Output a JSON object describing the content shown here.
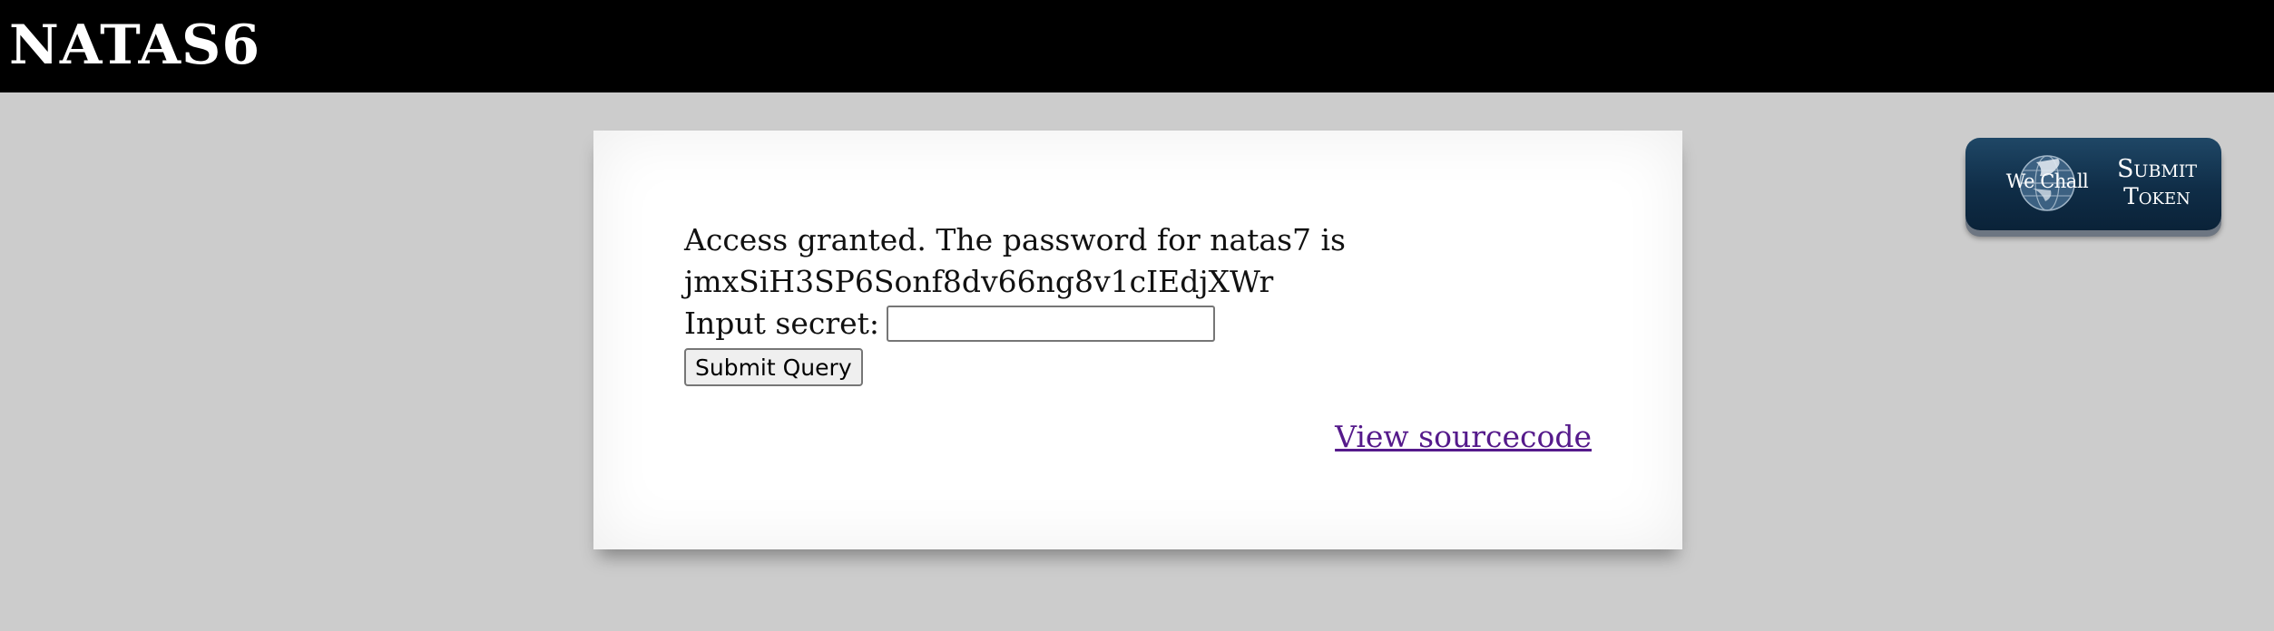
{
  "header": {
    "title": "NATAS6",
    "background": "#000000"
  },
  "main": {
    "message_line1": "Access granted. The password for natas7 is",
    "message_line2": "jmxSiH3SP6Sonf8dv66ng8v1cIEdjXWr",
    "input_label": "Input secret:",
    "input_value": "",
    "submit_label": "Submit Query",
    "source_link": "View sourcecode"
  },
  "token_button": {
    "logo_text": "We Chall",
    "label_line1": "Submit",
    "label_line2": "Token",
    "icon": "globe-icon"
  },
  "colors": {
    "page_background": "#cccccc",
    "link_visited": "#551a8b",
    "token_button": "#0f2d47"
  }
}
